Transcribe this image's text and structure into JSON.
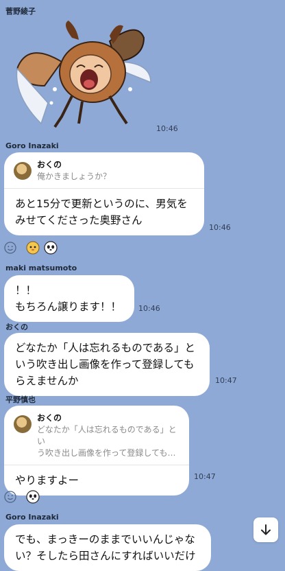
{
  "messages": {
    "m1": {
      "sender": "菅野綾子",
      "time": "10:46"
    },
    "m2": {
      "sender": "Goro Inazaki",
      "quote_name": "おくの",
      "quote_text": "俺かきましょうか？",
      "text": "あと15分で更新というのに、男気を\nみせてくださった奥野さん",
      "time": "10:46"
    },
    "m3": {
      "sender": "maki matsumoto",
      "text": "！！\nもちろん譲ります！！",
      "time": "10:46"
    },
    "m4": {
      "sender": "おくの",
      "text": "どなたか「人は忘れるものである」と\nいう吹き出し画像を作って登録しても\nらえませんか",
      "time": "10:47"
    },
    "m5": {
      "sender": "平野慎也",
      "quote_name": "おくの",
      "quote_text": "どなたか「人は忘れるものである」とい\nう吹き出し画像を作って登録しても…",
      "text": "やりますよー",
      "time": "10:47"
    },
    "m6": {
      "sender": "Goro Inazaki",
      "text": "でも、まっきーのままでいいんじゃな\nい？そしたら田さんにすればいいだけ"
    }
  },
  "icons": {
    "reaction_add": "smiley-outline-icon",
    "reaction_1": "hamster-face-emoji",
    "reaction_2": "panda-face-emoji",
    "scroll_down": "arrow-down-icon"
  },
  "colors": {
    "background": "#8fa9d6",
    "bubble": "#ffffff"
  }
}
